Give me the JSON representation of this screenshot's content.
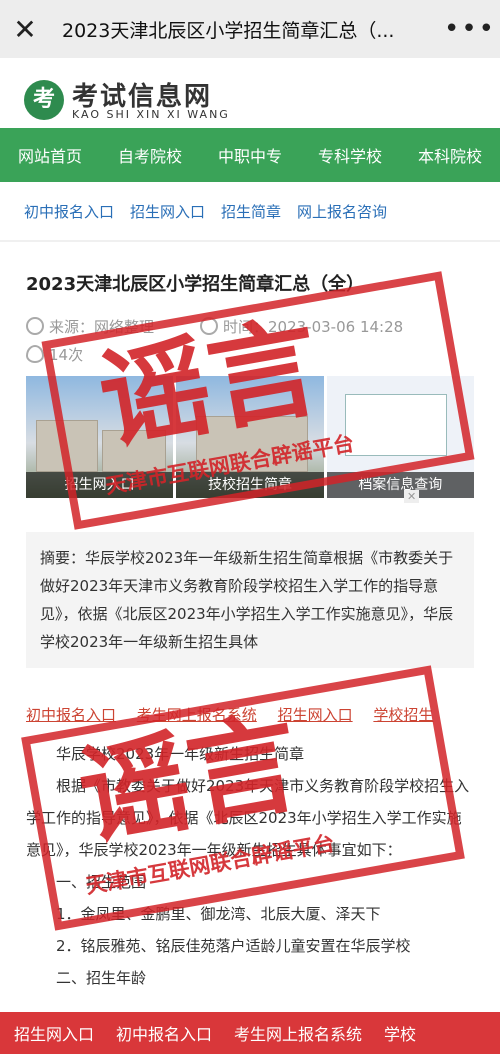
{
  "topbar": {
    "title": "2023天津北辰区小学招生简章汇总（...",
    "close_icon": "close-icon",
    "more_icon": "more-icon"
  },
  "site": {
    "logo_glyph": "考",
    "name": "考试信息网",
    "subtitle": "KAO SHI XIN XI WANG"
  },
  "mainnav": [
    "网站首页",
    "自考院校",
    "中职中专",
    "专科学校",
    "本科院校"
  ],
  "subnav": [
    "初中报名入口",
    "招生网入口",
    "招生简章",
    "网上报名咨询"
  ],
  "article": {
    "title": "2023天津北辰区小学招生简章汇总（全）",
    "source": "来源：网络整理",
    "time": "时间：2023-03-06 14:28",
    "views": "14次",
    "banners": [
      "招生网入口",
      "技校招生简章",
      "档案信息查询"
    ],
    "ad_close": "✕",
    "abstract": "摘要：华辰学校2023年一年级新生招生简章根据《市教委关于做好2023年天津市义务教育阶段学校招生入学工作的指导意见》，依据《北辰区2023年小学招生入学工作实施意见》，华辰学校2023年一年级新生招生具体",
    "links": [
      "初中报名入口",
      "考生网上报名系统",
      "招生网入口",
      "学校招生"
    ],
    "paragraphs": [
      "　　华辰学校2023年一年级新生招生简章",
      "　　根据《市教委关于做好2023年天津市义务教育阶段学校招生入学工作的指导意见》，依据《北辰区2023年小学招生入学工作实施意见》，华辰学校2023年一年级新生招生具体事宜如下：",
      "　　一、招生范围",
      "　　1．金凤里、金鹏里、御龙湾、北辰大厦、泽天下",
      "　　2．铭辰雅苑、铭辰佳苑落户适龄儿童安置在华辰学校",
      "　　二、招生年龄"
    ]
  },
  "stamp": {
    "big": "谣言",
    "label": "天津市互联网联合辟谣平台"
  },
  "bottombar": [
    "招生网入口",
    "初中报名入口",
    "考生网上报名系统",
    "学校"
  ]
}
